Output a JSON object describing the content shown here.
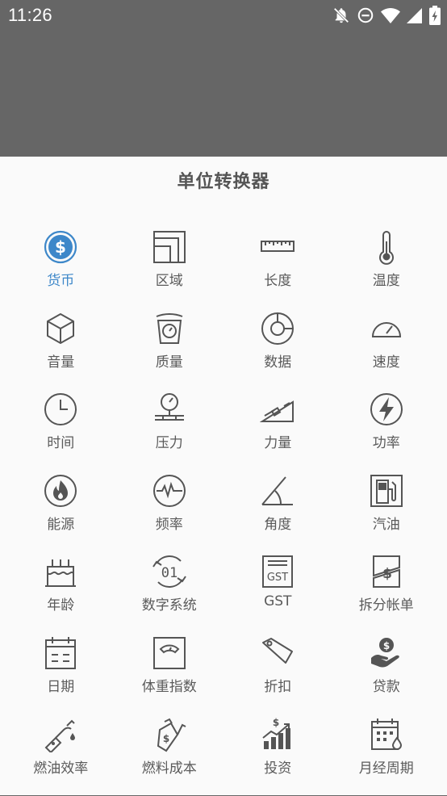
{
  "status_bar": {
    "time": "11:26",
    "icons": [
      "notifications-off-icon",
      "do-not-disturb-icon",
      "wifi-icon",
      "signal-icon",
      "battery-charging-icon"
    ]
  },
  "sheet": {
    "title": "单位转换器",
    "accent_color": "#3d87c9",
    "items": [
      {
        "label": "货币",
        "icon": "currency-icon",
        "active": true
      },
      {
        "label": "区域",
        "icon": "area-icon"
      },
      {
        "label": "长度",
        "icon": "ruler-icon"
      },
      {
        "label": "温度",
        "icon": "thermometer-icon"
      },
      {
        "label": "音量",
        "icon": "cube-icon"
      },
      {
        "label": "质量",
        "icon": "scale-icon"
      },
      {
        "label": "数据",
        "icon": "data-disc-icon"
      },
      {
        "label": "速度",
        "icon": "speedometer-icon"
      },
      {
        "label": "时间",
        "icon": "clock-icon"
      },
      {
        "label": "压力",
        "icon": "pressure-gauge-icon"
      },
      {
        "label": "力量",
        "icon": "incline-force-icon"
      },
      {
        "label": "功率",
        "icon": "lightning-icon"
      },
      {
        "label": "能源",
        "icon": "flame-icon"
      },
      {
        "label": "频率",
        "icon": "pulse-wave-icon"
      },
      {
        "label": "角度",
        "icon": "angle-icon"
      },
      {
        "label": "汽油",
        "icon": "fuel-pump-icon"
      },
      {
        "label": "年龄",
        "icon": "birthday-cake-icon"
      },
      {
        "label": "数字系统",
        "icon": "binary-number-icon"
      },
      {
        "label": "GST",
        "icon": "gst-receipt-icon"
      },
      {
        "label": "拆分帐单",
        "icon": "split-bill-icon"
      },
      {
        "label": "日期",
        "icon": "calendar-icon"
      },
      {
        "label": "体重指数",
        "icon": "bmi-scale-icon"
      },
      {
        "label": "折扣",
        "icon": "price-tag-icon"
      },
      {
        "label": "贷款",
        "icon": "loan-hand-icon"
      },
      {
        "label": "燃油效率",
        "icon": "fuel-efficiency-icon"
      },
      {
        "label": "燃料成本",
        "icon": "fuel-cost-icon"
      },
      {
        "label": "投资",
        "icon": "investment-chart-icon"
      },
      {
        "label": "月经周期",
        "icon": "period-calendar-icon"
      }
    ]
  }
}
